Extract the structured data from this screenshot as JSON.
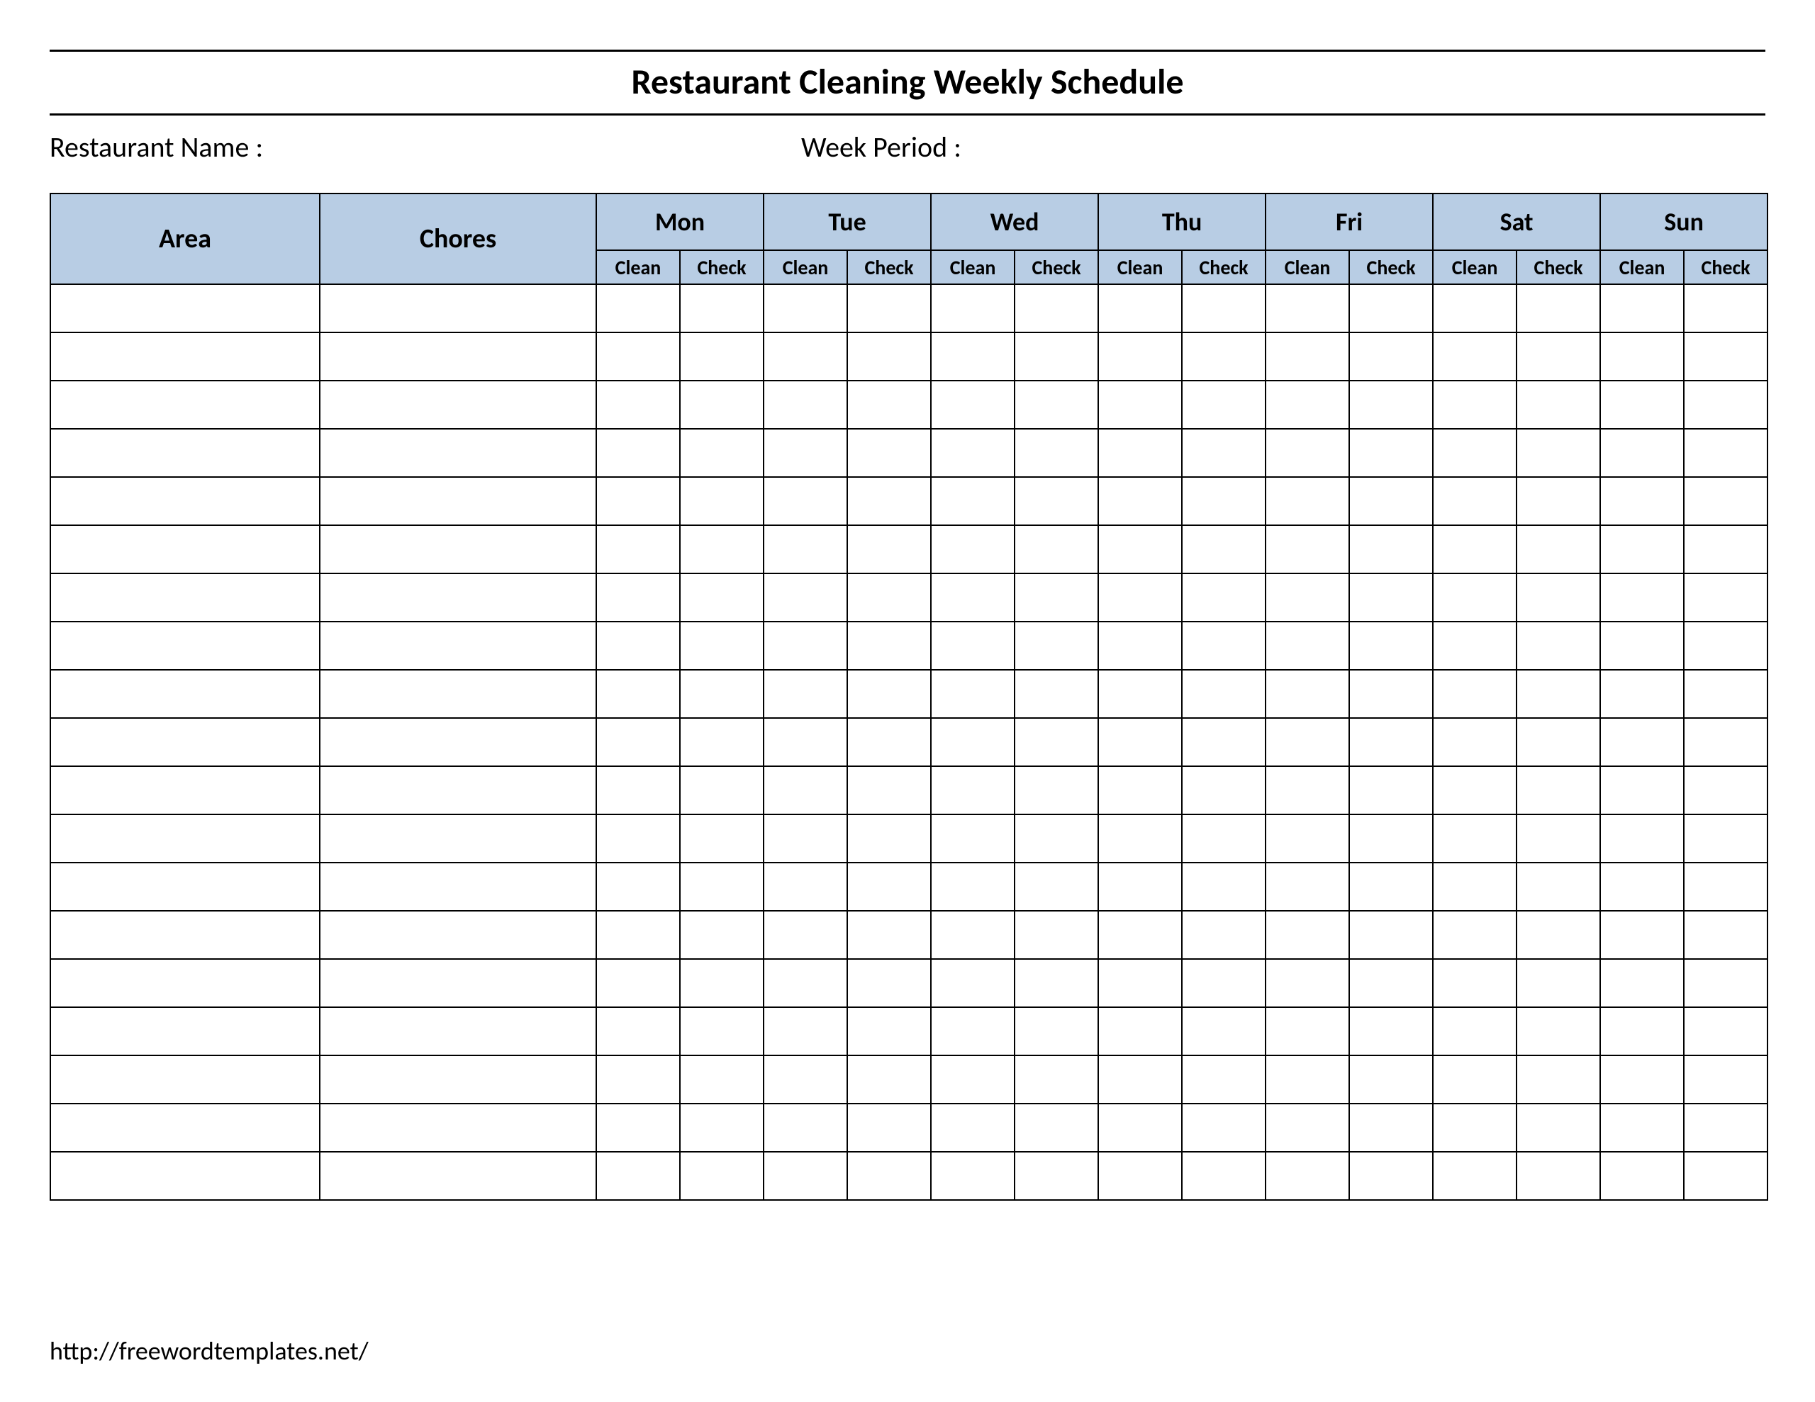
{
  "header": {
    "title": "Restaurant Cleaning Weekly Schedule",
    "restaurant_label": "Restaurant Name   :",
    "week_label": "Week  Period :"
  },
  "table": {
    "area_header": "Area",
    "chores_header": "Chores",
    "days": [
      "Mon",
      "Tue",
      "Wed",
      "Thu",
      "Fri",
      "Sat",
      "Sun"
    ],
    "sub": {
      "clean": "Clean",
      "check": "Check"
    },
    "body_rows": 19
  },
  "footer": {
    "source": "http://freewordtemplates.net/"
  }
}
